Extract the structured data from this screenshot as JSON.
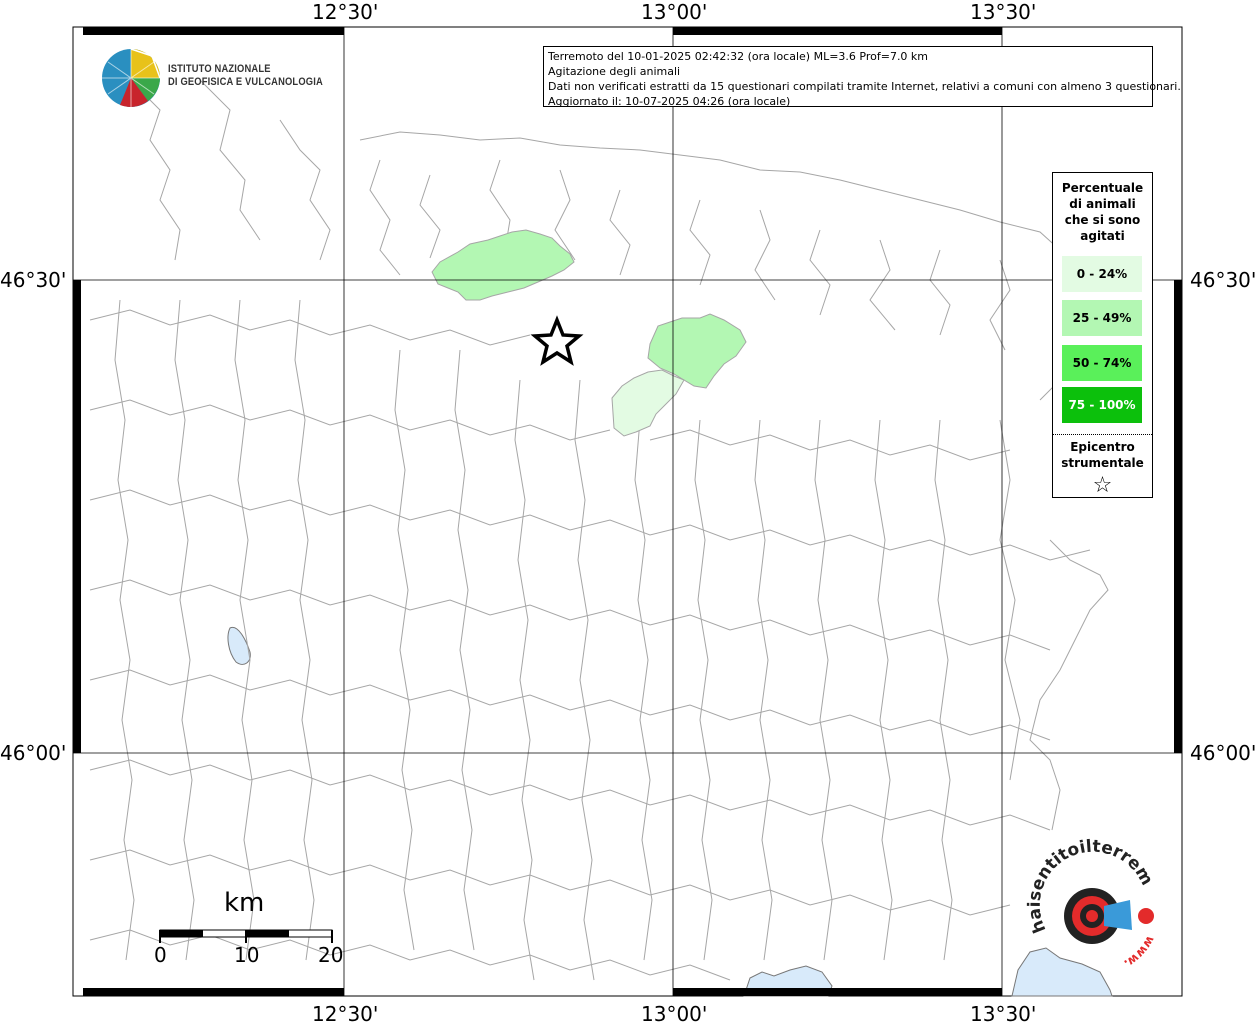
{
  "info_box": {
    "line1": "Terremoto del 10-01-2025 02:42:32 (ora locale) ML=3.6 Prof=7.0 km",
    "line2": "Agitazione degli animali",
    "line3": "Dati non verificati estratti da 15 questionari compilati tramite Internet, relativi a comuni con almeno 3 questionari.",
    "line4": "Aggiornato il: 10-07-2025 04:26 (ora locale)"
  },
  "ingv_logo": {
    "line1": "ISTITUTO NAZIONALE",
    "line2": "DI GEOFISICA E VULCANOLOGIA"
  },
  "sentito_logo": {
    "text": "haisentitoilterremoto.it",
    "prefix": "www."
  },
  "axes": {
    "longitude_ticks": [
      "12°30'",
      "13°00'",
      "13°30'"
    ],
    "latitude_ticks": [
      "46°30'",
      "46°00'"
    ]
  },
  "legend": {
    "title_lines": [
      "Percentuale",
      "di animali",
      "che si sono",
      "agitati"
    ],
    "classes": [
      {
        "label": "0 - 24%",
        "color": "#e3fbe3"
      },
      {
        "label": "25 - 49%",
        "color": "#b3f7b3"
      },
      {
        "label": "50 - 74%",
        "color": "#5af05a"
      },
      {
        "label": "75 - 100%",
        "color": "#0cc00c"
      }
    ],
    "epicenter_lines": [
      "Epicentro",
      "strumentale"
    ],
    "epicenter_symbol": "☆"
  },
  "scale_bar": {
    "unit": "km",
    "labels": [
      "0",
      "10",
      "20"
    ]
  },
  "colors": {
    "water": "#d8eafa",
    "boundary": "#a0a0a0",
    "grid": "#000000"
  }
}
